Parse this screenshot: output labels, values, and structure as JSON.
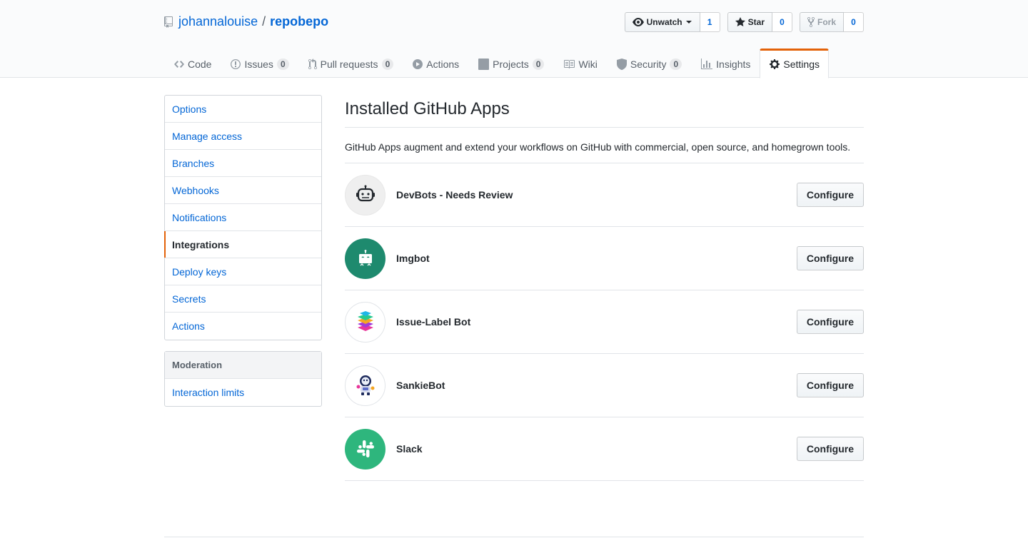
{
  "repo": {
    "owner": "johannalouise",
    "separator": "/",
    "name": "repobepo"
  },
  "actions": {
    "watch_label": "Unwatch",
    "watch_count": "1",
    "star_label": "Star",
    "star_count": "0",
    "fork_label": "Fork",
    "fork_count": "0"
  },
  "nav": {
    "code": "Code",
    "issues": "Issues",
    "issues_count": "0",
    "pulls": "Pull requests",
    "pulls_count": "0",
    "actions": "Actions",
    "projects": "Projects",
    "projects_count": "0",
    "wiki": "Wiki",
    "security": "Security",
    "security_count": "0",
    "insights": "Insights",
    "settings": "Settings"
  },
  "sidebar": {
    "items": [
      "Options",
      "Manage access",
      "Branches",
      "Webhooks",
      "Notifications",
      "Integrations",
      "Deploy keys",
      "Secrets",
      "Actions"
    ],
    "selected": "Integrations",
    "moderation_heading": "Moderation",
    "moderation_items": [
      "Interaction limits"
    ]
  },
  "main": {
    "title": "Installed GitHub Apps",
    "description": "GitHub Apps augment and extend your workflows on GitHub with commercial, open source, and homegrown tools.",
    "configure_label": "Configure",
    "apps": [
      {
        "name": "DevBots - Needs Review",
        "icon": "devbots-robot-icon"
      },
      {
        "name": "Imgbot",
        "icon": "imgbot-icon"
      },
      {
        "name": "Issue-Label Bot",
        "icon": "issue-label-stack-icon"
      },
      {
        "name": "SankieBot",
        "icon": "sankiebot-astronaut-icon"
      },
      {
        "name": "Slack",
        "icon": "slack-icon"
      }
    ]
  },
  "colors": {
    "accent": "#e36209",
    "link": "#0366d6",
    "imgbot_bg": "#1e8a6e",
    "slack_bg": "#2eb67d"
  }
}
